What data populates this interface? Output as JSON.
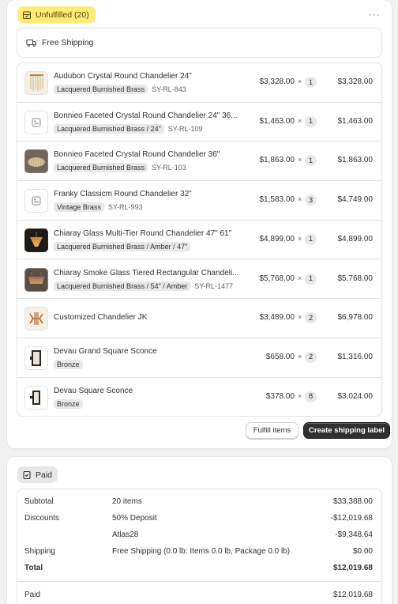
{
  "fulfillment": {
    "status_label": "Unfulfilled (20)",
    "more_label": "···",
    "shipping_method": "Free Shipping",
    "items": [
      {
        "name": "Audubon Crystal Round Chandelier 24\"",
        "variant": "Lacquered Burnished Brass",
        "sku": "SY-RL-843",
        "price": "$3,328.00",
        "times": "×",
        "qty": "1",
        "total": "$3,328.00",
        "thumb": "light"
      },
      {
        "name": "Bonnieo Faceted Crystal Round Chandelier 24\" 36...",
        "variant": "Lacquered Burnished Brass / 24\"",
        "sku": "SY-RL-109",
        "price": "$1,463.00",
        "times": "×",
        "qty": "1",
        "total": "$1,463.00",
        "thumb": "placeholder"
      },
      {
        "name": "Bonnieo Faceted Crystal Round Chandelier 36\"",
        "variant": "Lacquered Burnished Brass",
        "sku": "SY-RL-103",
        "price": "$1,863.00",
        "times": "×",
        "qty": "1",
        "total": "$1,863.00",
        "thumb": "mid"
      },
      {
        "name": "Franky Classicm Round Chandelier 32\"",
        "variant": "Vintage Brass",
        "sku": "SY-RL-993",
        "price": "$1,583.00",
        "times": "×",
        "qty": "3",
        "total": "$4,749.00",
        "thumb": "placeholder"
      },
      {
        "name": "Chiaray Glass Multi-Tier Round Chandelier 47\" 61\"",
        "variant": "Lacquered Burnished Brass / Amber / 47\"",
        "sku": "",
        "price": "$4,899.00",
        "times": "×",
        "qty": "1",
        "total": "$4,899.00",
        "thumb": "dark"
      },
      {
        "name": "Chiaray Smoke Glass Tiered Rectangular Chandeli...",
        "variant": "Lacquered Burnished Brass / 54\" / Amber",
        "sku": "SY-RL-1477",
        "price": "$5,768.00",
        "times": "×",
        "qty": "1",
        "total": "$5,768.00",
        "thumb": "mid"
      },
      {
        "name": "Customized Chandelier JK",
        "variant": "",
        "sku": "",
        "price": "$3,489.00",
        "times": "×",
        "qty": "2",
        "total": "$6,978.00",
        "thumb": "light"
      },
      {
        "name": "Devau Grand Square Sconce",
        "variant": "Bronze",
        "sku": "",
        "price": "$658.00",
        "times": "×",
        "qty": "2",
        "total": "$1,316.00",
        "thumb": "light"
      },
      {
        "name": "Devau Square Sconce",
        "variant": "Bronze",
        "sku": "",
        "price": "$378.00",
        "times": "×",
        "qty": "8",
        "total": "$3,024.00",
        "thumb": "light"
      }
    ],
    "fulfill_button": "Fulfill items",
    "shipping_label_button": "Create shipping label"
  },
  "payment": {
    "status_label": "Paid",
    "rows": [
      {
        "label": "Subtotal",
        "desc": "20 items",
        "amount": "$33,388.00"
      },
      {
        "label": "Discounts",
        "desc": "50% Deposit",
        "amount": "-$12,019.68"
      },
      {
        "label": "",
        "desc": "Atlas28",
        "amount": "-$9,348.64"
      },
      {
        "label": "Shipping",
        "desc": "Free Shipping (0.0 lb: Items 0.0 lb, Package 0.0 lb)",
        "amount": "$0.00"
      },
      {
        "label": "Total",
        "desc": "",
        "amount": "$12,019.68"
      }
    ],
    "paid_label": "Paid",
    "paid_amount": "$12,019.68"
  },
  "colors": {
    "unfulfilled_badge": "#ffeb78",
    "primary_button": "#303030"
  }
}
